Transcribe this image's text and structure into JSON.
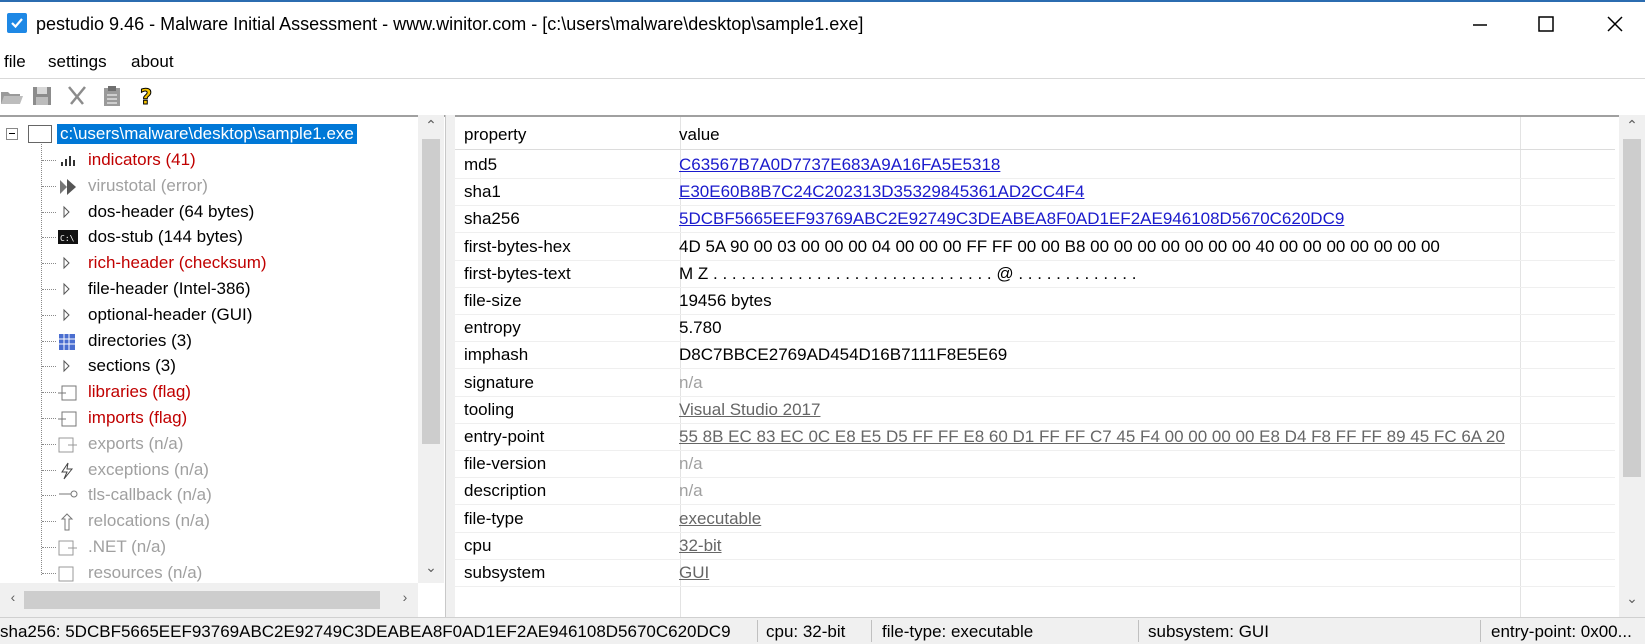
{
  "window": {
    "title": "pestudio 9.46 - Malware Initial Assessment - www.winitor.com - [c:\\users\\malware\\desktop\\sample1.exe]",
    "minimize_glyph": "—",
    "maximize_glyph": "☐",
    "close_glyph": "✕"
  },
  "menu": {
    "file": "file",
    "settings": "settings",
    "about": "about"
  },
  "toolbar": {
    "icons": [
      "open-folder-icon",
      "save-icon",
      "cut-icon",
      "clipboard-icon",
      "help-icon"
    ]
  },
  "tree": {
    "root": "c:\\users\\malware\\desktop\\sample1.exe",
    "items": [
      {
        "label": "indicators (41)",
        "style": "red",
        "icon": "bar-chart-icon"
      },
      {
        "label": "virustotal (error)",
        "style": "gray",
        "icon": "play-arrow-icon"
      },
      {
        "label": "dos-header (64 bytes)",
        "style": "normal",
        "icon": "expand-arrow-icon"
      },
      {
        "label": "dos-stub (144 bytes)",
        "style": "normal",
        "icon": "console-icon"
      },
      {
        "label": "rich-header (checksum)",
        "style": "red",
        "icon": "expand-arrow-icon"
      },
      {
        "label": "file-header (Intel-386)",
        "style": "normal",
        "icon": "expand-arrow-icon"
      },
      {
        "label": "optional-header (GUI)",
        "style": "normal",
        "icon": "expand-arrow-icon"
      },
      {
        "label": "directories (3)",
        "style": "normal",
        "icon": "grid-icon"
      },
      {
        "label": "sections (3)",
        "style": "normal",
        "icon": "expand-arrow-icon"
      },
      {
        "label": "libraries (flag)",
        "style": "red",
        "icon": "library-icon"
      },
      {
        "label": "imports (flag)",
        "style": "red",
        "icon": "import-icon"
      },
      {
        "label": "exports (n/a)",
        "style": "gray",
        "icon": "export-icon"
      },
      {
        "label": "exceptions (n/a)",
        "style": "gray",
        "icon": "lightning-icon"
      },
      {
        "label": "tls-callback (n/a)",
        "style": "gray",
        "icon": "key-icon"
      },
      {
        "label": "relocations (n/a)",
        "style": "gray",
        "icon": "relocation-icon"
      },
      {
        "label": ".NET (n/a)",
        "style": "gray",
        "icon": "dotnet-icon"
      },
      {
        "label": "resources (n/a)",
        "style": "gray",
        "icon": "resource-icon"
      }
    ]
  },
  "table": {
    "headers": {
      "property": "property",
      "value": "value"
    },
    "rows": [
      {
        "property": "md5",
        "value": "C63567B7A0D7737E683A9A16FA5E5318",
        "style": "link"
      },
      {
        "property": "sha1",
        "value": "E30E60B8B7C24C202313D35329845361AD2CC4F4",
        "style": "link"
      },
      {
        "property": "sha256",
        "value": "5DCBF5665EEF93769ABC2E92749C3DEABEA8F0AD1EF2AE946108D5670C620DC9",
        "style": "link"
      },
      {
        "property": "first-bytes-hex",
        "value": "4D 5A 90 00 03 00 00 00 04 00 00 00 FF FF 00 00 B8 00 00 00 00 00 00 00 40 00 00 00 00 00 00 00",
        "style": "normal"
      },
      {
        "property": "first-bytes-text",
        "value": "M Z . . . . . . . . . . . . . . . . . . . . . . . . . . . . . . @ . . . . . . . . . . . . .",
        "style": "normal"
      },
      {
        "property": "file-size",
        "value": "19456 bytes",
        "style": "normal"
      },
      {
        "property": "entropy",
        "value": "5.780",
        "style": "normal"
      },
      {
        "property": "imphash",
        "value": "D8C7BBCE2769AD454D16B7111F8E5E69",
        "style": "normal"
      },
      {
        "property": "signature",
        "value": "n/a",
        "style": "gray"
      },
      {
        "property": "tooling",
        "value": "Visual Studio 2017",
        "style": "ulgray"
      },
      {
        "property": "entry-point",
        "value": "55 8B EC 83 EC 0C E8 E5 D5 FF FF E8 60 D1 FF FF C7 45 F4 00 00 00 00 E8 D4 F8 FF FF 89 45 FC 6A 20",
        "style": "ulgray"
      },
      {
        "property": "file-version",
        "value": "n/a",
        "style": "gray"
      },
      {
        "property": "description",
        "value": "n/a",
        "style": "gray"
      },
      {
        "property": "file-type",
        "value": "executable",
        "style": "ulgray"
      },
      {
        "property": "cpu",
        "value": "32-bit",
        "style": "ulgray"
      },
      {
        "property": "subsystem",
        "value": "GUI",
        "style": "ulgray"
      }
    ]
  },
  "status": {
    "sha256": "sha256: 5DCBF5665EEF93769ABC2E92749C3DEABEA8F0AD1EF2AE946108D5670C620DC9",
    "cpu": "cpu: 32-bit",
    "file_type": "file-type: executable",
    "subsystem": "subsystem: GUI",
    "entry_point": "entry-point: 0x00..."
  },
  "colors": {
    "selection": "#0078d7",
    "flag_red": "#c00000",
    "link_blue": "#1a1acc",
    "muted_gray": "#a0a0a0"
  }
}
